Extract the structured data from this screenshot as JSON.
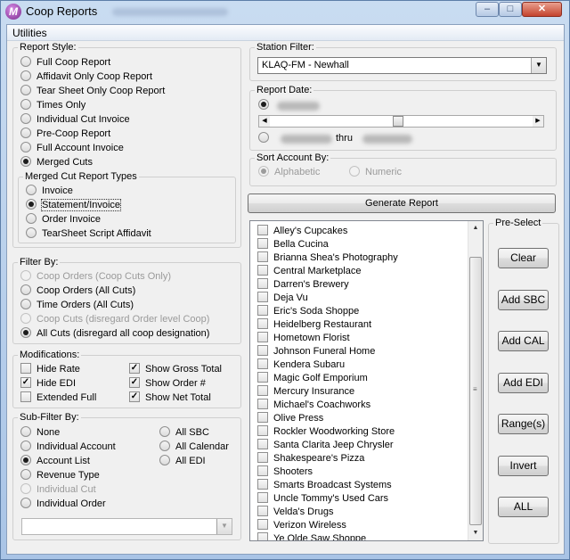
{
  "window": {
    "title": "Coop Reports",
    "icon": "app-logo-icon",
    "controls": {
      "minimize": "–",
      "maximize": "□",
      "close": "✕"
    }
  },
  "menu": {
    "utilities": "Utilities"
  },
  "report_style": {
    "label": "Report Style:",
    "options": [
      "Full Coop Report",
      "Affidavit Only Coop Report",
      "Tear Sheet Only Coop Report",
      "Times Only",
      "Individual Cut Invoice",
      "Pre-Coop Report",
      "Full Account Invoice",
      "Merged Cuts"
    ],
    "selected": "Merged Cuts",
    "merged_cut_types": {
      "label": "Merged Cut Report Types",
      "options": [
        "Invoice",
        "Statement/Invoice",
        "Order Invoice",
        "TearSheet Script Affidavit"
      ],
      "selected": "Statement/Invoice"
    }
  },
  "filter_by": {
    "label": "Filter By:",
    "options": [
      "Coop Orders (Coop Cuts Only)",
      "Coop Orders (All Cuts)",
      "Time Orders (All Cuts)",
      "Coop Cuts (disregard Order level Coop)",
      "All Cuts (disregard all coop designation)"
    ],
    "selected": "All Cuts (disregard all coop designation)"
  },
  "modifications": {
    "label": "Modifications:",
    "hide_rate": "Hide Rate",
    "hide_edi": "Hide EDI",
    "extended_full": "Extended Full",
    "show_gross_total": "Show Gross Total",
    "show_order_no": "Show Order #",
    "show_net_total": "Show Net Total",
    "checked": [
      "Hide EDI",
      "Show Gross Total",
      "Show Order #",
      "Show Net Total"
    ]
  },
  "sub_filter": {
    "label": "Sub-Filter By:",
    "none": "None",
    "individual_account": "Individual Account",
    "account_list": "Account List",
    "revenue_type": "Revenue Type",
    "individual_cut": "Individual Cut",
    "individual_order": "Individual Order",
    "all_sbc": "All SBC",
    "all_calendar": "All Calendar",
    "all_edi": "All EDI",
    "selected": "Account List",
    "combo_value": ""
  },
  "station_filter": {
    "label": "Station Filter:",
    "value": "KLAQ-FM - Newhall"
  },
  "report_date": {
    "label": "Report Date:",
    "thru": "thru"
  },
  "sort_account_by": {
    "label": "Sort Account By:",
    "alphabetic": "Alphabetic",
    "numeric": "Numeric",
    "selected": "Alphabetic"
  },
  "generate_button": "Generate Report",
  "accounts": [
    "Alley's Cupcakes",
    "Bella Cucina",
    "Brianna Shea's Photography",
    "Central Marketplace",
    "Darren's Brewery",
    "Deja Vu",
    "Eric's Soda Shoppe",
    "Heidelberg Restaurant",
    "Hometown Florist",
    "Johnson Funeral Home",
    "Kendera Subaru",
    "Magic Golf Emporium",
    "Mercury Insurance",
    "Michael's Coachworks",
    "Olive Press",
    "Rockler Woodworking Store",
    "Santa Clarita Jeep Chrysler",
    "Shakespeare's Pizza",
    "Shooters",
    "Smarts Broadcast Systems",
    "Uncle Tommy's Used Cars",
    "Velda's Drugs",
    "Verizon Wireless",
    "Ye Olde Saw Shoppe"
  ],
  "pre_select": {
    "label": "Pre-Select",
    "buttons": [
      "Clear",
      "Add SBC",
      "Add CAL",
      "Add EDI",
      "Range(s)",
      "Invert",
      "ALL"
    ]
  }
}
